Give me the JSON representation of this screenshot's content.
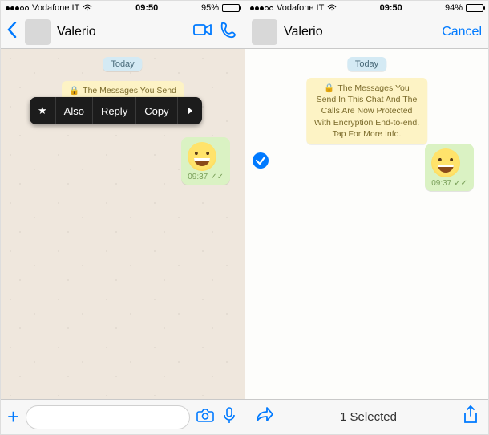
{
  "left": {
    "status": {
      "carrier": "Vodafone IT",
      "time": "09:50",
      "battery": "95%"
    },
    "header": {
      "name": "Valerio"
    },
    "chat": {
      "date": "Today",
      "encryption": "The Messages You Send In This Chat And The",
      "context_menu": {
        "star": "★",
        "also": "Also",
        "reply": "Reply",
        "copy": "Copy"
      },
      "msg": {
        "time": "09:37",
        "emoji": "grinning-face"
      }
    }
  },
  "right": {
    "status": {
      "carrier": "Vodafone IT",
      "time": "09:50",
      "battery": "94%"
    },
    "header": {
      "name": "Valerio",
      "cancel": "Cancel"
    },
    "chat": {
      "date": "Today",
      "encryption": "The Messages You Send In This Chat And The Calls Are Now Protected With Encryption End-to-end. Tap For More Info.",
      "msg": {
        "time": "09:37",
        "emoji": "grinning-face"
      }
    },
    "footer": {
      "selected": "1 Selected"
    }
  }
}
